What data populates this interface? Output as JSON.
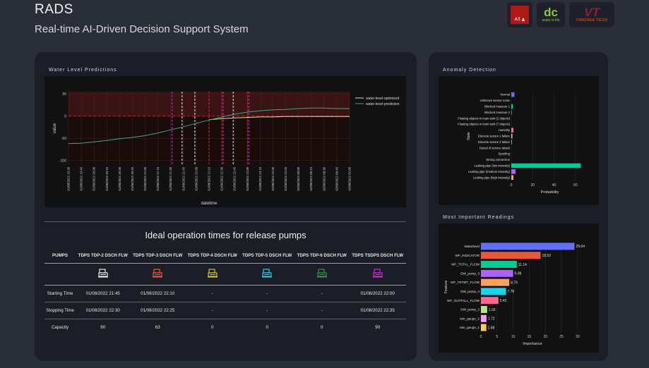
{
  "header": {
    "title": "RADS",
    "subtitle": "Real-time AI-Driven Decision Support System",
    "logos": [
      {
        "name": "a3-logo",
        "text": "A3 ▲"
      },
      {
        "name": "dc-water-logo",
        "text": "dc",
        "sub": "water is life"
      },
      {
        "name": "virginia-tech-logo",
        "text": "VT",
        "sub": "VIRGINIA TECH"
      }
    ]
  },
  "water_chart_title": "Water Level Predictions",
  "anomaly_chart_title": "Anomaly Detection",
  "readings_chart_title": "Most Important Readings",
  "chart_data": [
    {
      "type": "line",
      "title": "Water Level Predictions",
      "xlabel": "datetime",
      "ylabel": "value",
      "ylim": [
        -110,
        55
      ],
      "yticks": [
        50,
        0,
        -50,
        -100
      ],
      "x": [
        "01/08/2022 19:30",
        "01/08/2022 19:45",
        "01/08/2022 20:00",
        "01/08/2022 20:15",
        "01/08/2022 20:30",
        "01/08/2022 20:45",
        "01/08/2022 21:00",
        "01/08/2022 21:15",
        "01/08/2022 21:30",
        "01/08/2022 21:45",
        "01/08/2022 22:00",
        "01/08/2022 22:15",
        "01/08/2022 22:30",
        "01/08/2022 22:45",
        "01/08/2022 23:00",
        "01/08/2022 23:15",
        "01/08/2022 23:30",
        "01/08/2022 23:45",
        "02/08/2022 00:00",
        "02/08/2022 00:15",
        "02/08/2022 00:30",
        "02/08/2022 00:45",
        "02/08/2022 01:00"
      ],
      "legend_position": "top-right",
      "series": [
        {
          "name": "water-level-optimized",
          "color": "#c7f0a0",
          "values": [
            null,
            null,
            null,
            null,
            null,
            null,
            null,
            null,
            null,
            null,
            null,
            -8,
            -6,
            -4,
            -3,
            -2,
            -2,
            -1,
            -1,
            -1,
            -1,
            -1,
            -1
          ]
        },
        {
          "name": "water-level-prediction",
          "color": "#3aa88c",
          "values": [
            -62,
            -61,
            -58,
            -55,
            -51,
            -48,
            -44,
            -38,
            -31,
            -24,
            -16,
            -9,
            -2,
            4,
            9,
            12,
            14,
            15,
            17,
            18,
            18,
            17,
            17
          ]
        }
      ],
      "shapes": {
        "band_positive_color": "#3a1414",
        "band_negative_color": "#1a0b0b",
        "zero_line_color": "#d62828",
        "white_dashed_x": [
          "01/08/2022 21:45",
          "01/08/2022 22:00",
          "01/08/2022 22:45"
        ],
        "red_dashed_x": [
          "01/08/2022 22:15",
          "01/08/2022 22:30",
          "01/08/2022 23:00"
        ],
        "magenta_dashed_x": [
          "01/08/2022 21:30",
          "01/08/2022 22:30",
          "01/08/2022 23:00"
        ]
      }
    },
    {
      "type": "bar",
      "orientation": "horizontal",
      "title": "Anomaly Detection",
      "xlabel": "Probability",
      "ylabel": "State",
      "xlim": [
        0,
        72
      ],
      "xticks": [
        0,
        20,
        40,
        60
      ],
      "categories": [
        "Normal",
        "Unknown sensor noise",
        "Blocked measure 1",
        "Blocked measure 2",
        "Floating objects in main tank (2 objects)",
        "Floating objects in main tank (7 objects)",
        "Humidity",
        "Discrete sensor 1 failure",
        "Discrete sensor 2 failure",
        "Denial of service attack",
        "Spoofing",
        "Wrong connection",
        "Leaking pipe (low intensity)",
        "Leaking pipe (medium intensity)",
        "Leaking pipe (high intensity)"
      ],
      "values": [
        3,
        0,
        1.5,
        0.5,
        0,
        0,
        2,
        1,
        0.5,
        0,
        0,
        0,
        65,
        4,
        2
      ],
      "colors": [
        "#636efa",
        "#636efa",
        "#00cc96",
        "#ab63fa",
        "#ffa15a",
        "#19d3f3",
        "#ff6692",
        "#b6e880",
        "#ff97ff",
        "#fecb52",
        "#636efa",
        "#ef553b",
        "#00cc96",
        "#ab63fa",
        "#ffa15a"
      ]
    },
    {
      "type": "bar",
      "orientation": "horizontal",
      "title": "Most Important Readings",
      "xlabel": "Importance",
      "ylabel": "Feature",
      "xlim": [
        0,
        32
      ],
      "xticks": [
        0,
        5,
        10,
        15,
        20,
        25,
        30
      ],
      "categories": [
        "Waterlevel",
        "WF_INDICATOR",
        "WF_TOTAL_FLOW",
        "DW_pump_3",
        "WF_TRTMT_FLOW",
        "DW_pump_4",
        "WF_OUTFALL_FLOW",
        "DW_pump_2",
        "rain_gauge_2",
        "rain_gauge_1"
      ],
      "values": [
        29.04,
        18.52,
        11.14,
        9.98,
        8.79,
        7.78,
        5.42,
        1.93,
        1.72,
        1.68
      ],
      "labels": [
        "29.04",
        "18.52",
        "11.14",
        "9.98",
        "8.79",
        "7.78",
        "5.42",
        "1.93",
        "1.72",
        "1.68"
      ],
      "colors": [
        "#636efa",
        "#ef553b",
        "#00cc96",
        "#ab63fa",
        "#ffa15a",
        "#19d3f3",
        "#ff6692",
        "#b6e880",
        "#ff97ff",
        "#fecb52"
      ]
    }
  ],
  "pumps": {
    "title": "Ideal operation times for release pumps",
    "headers": [
      "PUMPS",
      "TDPS TDP-2 DSCH FLW",
      "TDPS TDP-3 DSCH FLW",
      "TDPS TDP-4 DSCH FLW",
      "TDPS TDP-5 DSCH FLW",
      "TDPS TDP-6 DSCH FLW",
      "TDPS TSDPS DSCH FLW"
    ],
    "icon_colors": [
      "#e8e8e8",
      "#ef553b",
      "#d8c030",
      "#19d3f3",
      "#2a9a3a",
      "#e020e0"
    ],
    "rows": [
      {
        "label": "Starting Time",
        "values": [
          "01/08/2022 21:45",
          "01/08/2022 22:10",
          "-",
          "-",
          "-",
          "01/08/2022 22:00"
        ]
      },
      {
        "label": "Stopping Time",
        "values": [
          "01/08/2022 22:30",
          "01/08/2022 22:25",
          "-",
          "-",
          "-",
          "01/08/2022 22:35"
        ]
      },
      {
        "label": "Capacity",
        "values": [
          "90",
          "63",
          "0",
          "0",
          "0",
          "90"
        ]
      }
    ]
  }
}
